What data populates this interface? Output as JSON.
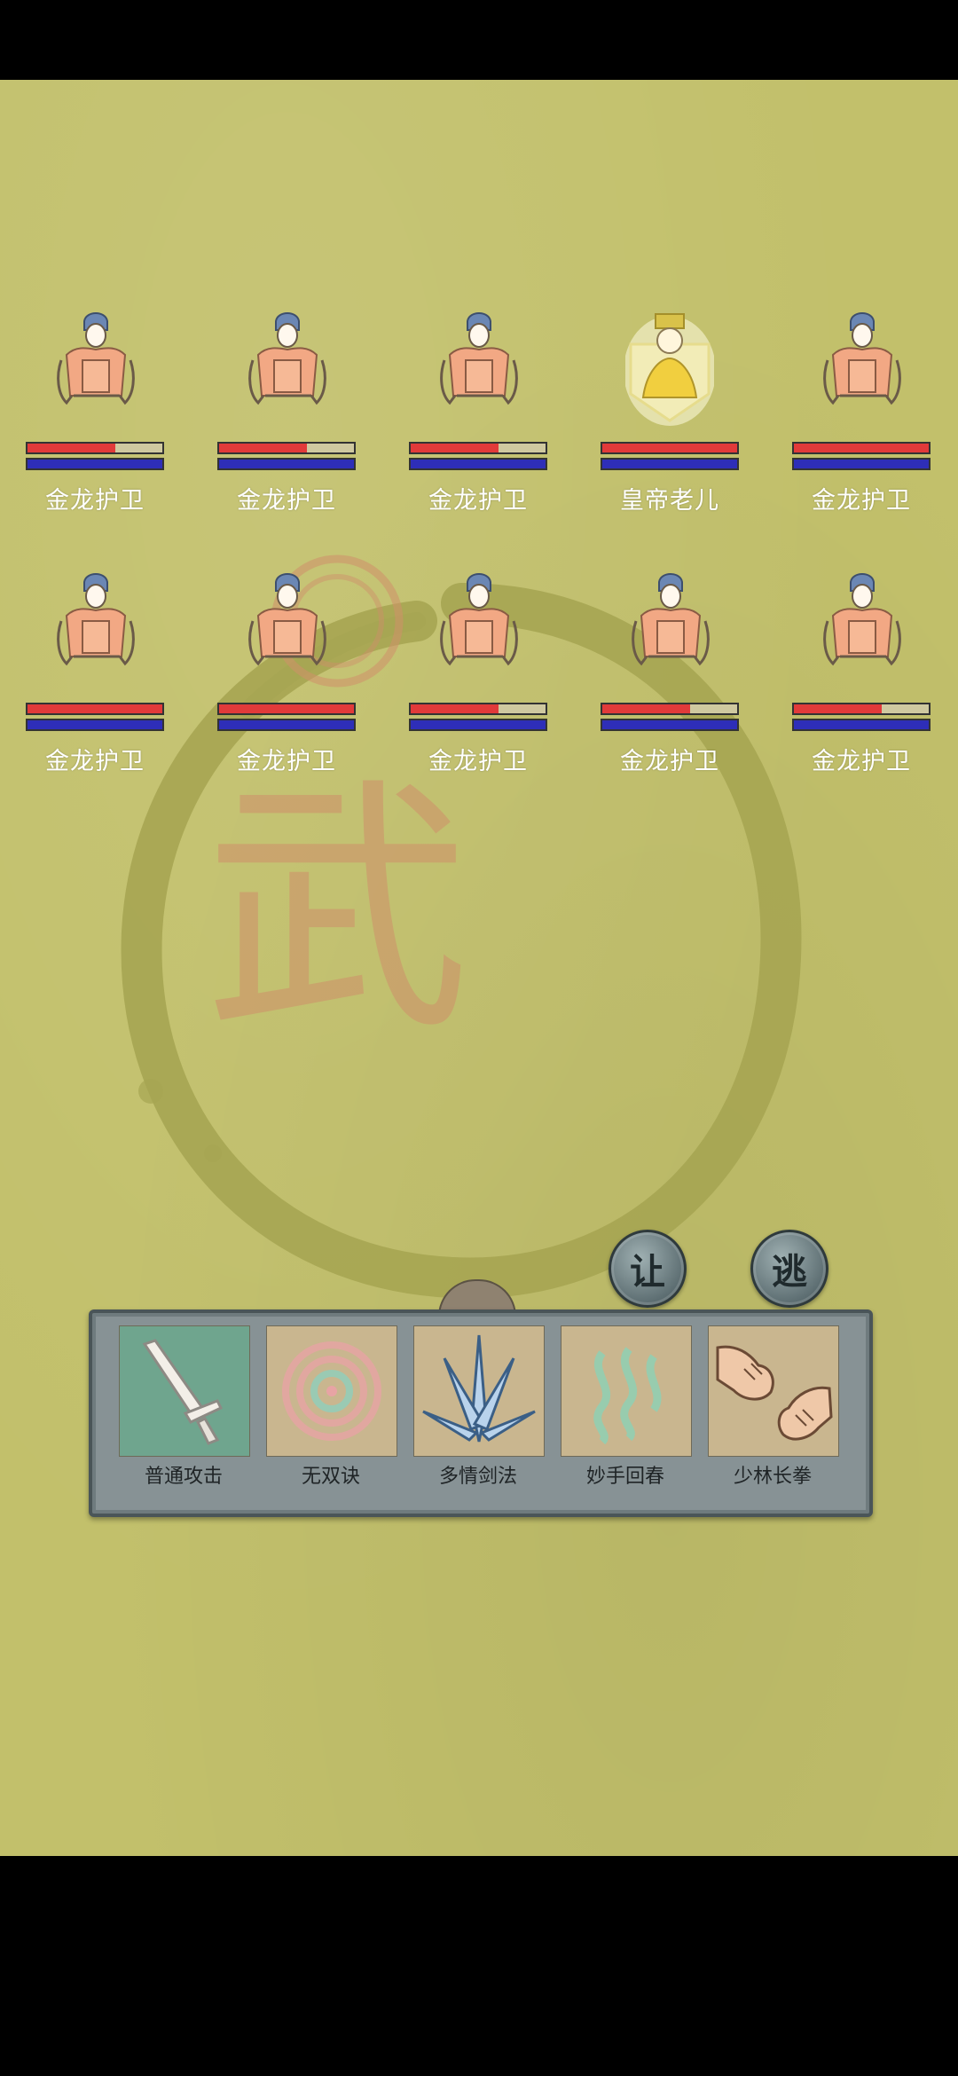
{
  "enemies": [
    {
      "name": "金龙护卫",
      "hp": 0.65,
      "mp": 1.0,
      "kind": "guard"
    },
    {
      "name": "金龙护卫",
      "hp": 0.65,
      "mp": 1.0,
      "kind": "guard"
    },
    {
      "name": "金龙护卫",
      "hp": 0.65,
      "mp": 1.0,
      "kind": "guard"
    },
    {
      "name": "皇帝老儿",
      "hp": 1.0,
      "mp": 1.0,
      "kind": "emperor"
    },
    {
      "name": "金龙护卫",
      "hp": 1.0,
      "mp": 1.0,
      "kind": "guard"
    },
    {
      "name": "金龙护卫",
      "hp": 1.0,
      "mp": 1.0,
      "kind": "guard"
    },
    {
      "name": "金龙护卫",
      "hp": 1.0,
      "mp": 1.0,
      "kind": "guard"
    },
    {
      "name": "金龙护卫",
      "hp": 0.65,
      "mp": 1.0,
      "kind": "guard"
    },
    {
      "name": "金龙护卫",
      "hp": 0.65,
      "mp": 1.0,
      "kind": "guard"
    },
    {
      "name": "金龙护卫",
      "hp": 0.65,
      "mp": 1.0,
      "kind": "guard"
    }
  ],
  "buttons": {
    "yield_label": "让",
    "flee_label": "逃"
  },
  "background_glyph": "武",
  "skills": [
    {
      "label": "普通攻击",
      "icon": "sword-icon"
    },
    {
      "label": "无双诀",
      "icon": "spiral-icon"
    },
    {
      "label": "多情剑法",
      "icon": "blades-icon"
    },
    {
      "label": "妙手回春",
      "icon": "heal-waves-icon"
    },
    {
      "label": "少林长拳",
      "icon": "fist-icon"
    }
  ],
  "colors": {
    "background": "#c2c06b",
    "hp": "#e13a3a",
    "mp": "#2e2eb8"
  }
}
